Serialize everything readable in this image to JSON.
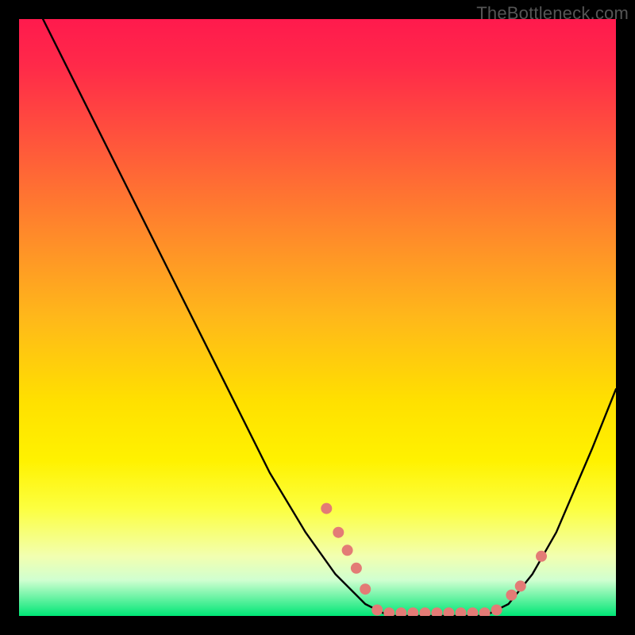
{
  "watermark": "TheBottleneck.com",
  "colors": {
    "background": "#000000",
    "curve": "#000000",
    "dot": "#e37b76"
  },
  "chart_data": {
    "type": "line",
    "title": "",
    "xlabel": "",
    "ylabel": "",
    "xlim": [
      0,
      100
    ],
    "ylim": [
      0,
      100
    ],
    "grid": false,
    "legend": false,
    "curve_points": [
      {
        "x": 4,
        "y": 100
      },
      {
        "x": 10,
        "y": 88
      },
      {
        "x": 18,
        "y": 72
      },
      {
        "x": 26,
        "y": 56
      },
      {
        "x": 34,
        "y": 40
      },
      {
        "x": 42,
        "y": 24
      },
      {
        "x": 48,
        "y": 14
      },
      {
        "x": 53,
        "y": 7
      },
      {
        "x": 58,
        "y": 2
      },
      {
        "x": 62,
        "y": 0
      },
      {
        "x": 70,
        "y": 0
      },
      {
        "x": 78,
        "y": 0
      },
      {
        "x": 82,
        "y": 2
      },
      {
        "x": 86,
        "y": 7
      },
      {
        "x": 90,
        "y": 14
      },
      {
        "x": 96,
        "y": 28
      },
      {
        "x": 100,
        "y": 38
      }
    ],
    "dots": [
      {
        "x": 51.5,
        "y": 18
      },
      {
        "x": 53.5,
        "y": 14
      },
      {
        "x": 55,
        "y": 11
      },
      {
        "x": 56.5,
        "y": 8
      },
      {
        "x": 58,
        "y": 4.5
      },
      {
        "x": 60,
        "y": 1
      },
      {
        "x": 62,
        "y": 0.5
      },
      {
        "x": 64,
        "y": 0.5
      },
      {
        "x": 66,
        "y": 0.5
      },
      {
        "x": 68,
        "y": 0.5
      },
      {
        "x": 70,
        "y": 0.5
      },
      {
        "x": 72,
        "y": 0.5
      },
      {
        "x": 74,
        "y": 0.5
      },
      {
        "x": 76,
        "y": 0.5
      },
      {
        "x": 78,
        "y": 0.5
      },
      {
        "x": 80,
        "y": 1
      },
      {
        "x": 82.5,
        "y": 3.5
      },
      {
        "x": 84,
        "y": 5
      },
      {
        "x": 87.5,
        "y": 10
      }
    ]
  }
}
